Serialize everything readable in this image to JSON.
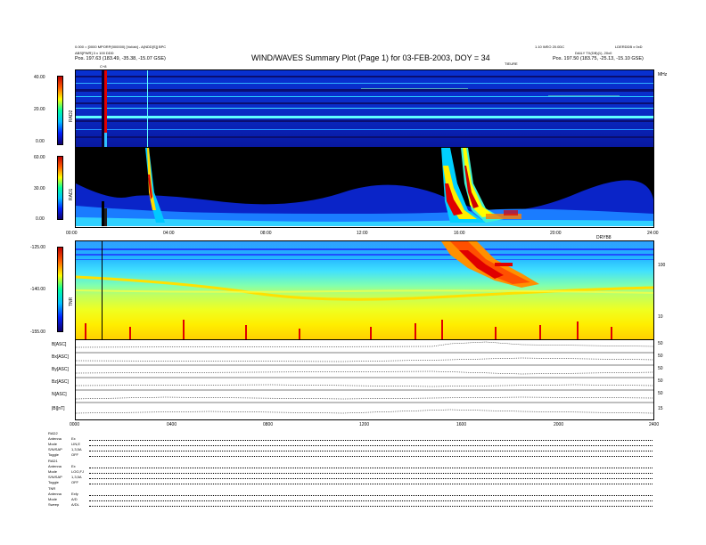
{
  "header": {
    "title": "WIND/WAVES Summary Plot (Page 1) for 03-FEB-2003, DOY = 34",
    "left_line1": "0.000 = [0000 MPORP(000000) [Vol/ab] - A(NDD[S]] BPC",
    "left_line2": "ABS[PWR] 3 x 100 DDD",
    "left_pos": "Pos.   197.63 (183.49, -35.38, -15.07 GSE)",
    "right_line1": "1.10 WEO 20.0DC",
    "right_line1b": "LDERDDB x 0xD",
    "right_line2": "DAILY TX(DB)(1), 20x0",
    "right_pos": "Pos.   197.50 (183.75, -25.13, -15.10 GSE)",
    "top_marker": "C+8",
    "top_mid_label": "TIEURE"
  },
  "chart_data": [
    {
      "type": "heatmap",
      "name": "RAD2",
      "ylabel": "RAD2",
      "colorbar_ticks": [
        "40.00",
        "20.00",
        "0.00"
      ],
      "right_label": "MHz",
      "right_tick": "13"
    },
    {
      "type": "heatmap",
      "name": "RAD1",
      "ylabel": "RAD1",
      "colorbar_ticks": [
        "60.00",
        "30.00",
        "0.00"
      ],
      "xticks": [
        "00:00",
        "04:00",
        "08:00",
        "12:00",
        "16:00",
        "20:00",
        "24:00"
      ],
      "x_units": "DRYB8"
    },
    {
      "type": "heatmap",
      "name": "TNR",
      "ylabel": "TNR",
      "colorbar_ticks": [
        "-125.00",
        "-140.00",
        "-155.00"
      ],
      "right_ticks": [
        "100",
        "10"
      ]
    },
    {
      "type": "line",
      "name": "MFI / SWE summary",
      "panels": [
        {
          "label": "B[ASC]",
          "right_ticks": [
            "50",
            "0"
          ]
        },
        {
          "label": "Bx[ASC]",
          "right_ticks": [
            "50",
            "0"
          ]
        },
        {
          "label": "By[ASC]",
          "right_ticks": [
            "50",
            "0"
          ]
        },
        {
          "label": "Bz[ASC]",
          "right_ticks": [
            "50",
            "0"
          ]
        },
        {
          "label": "N[ASC]",
          "right_ticks": [
            "50",
            "0"
          ]
        },
        {
          "label": "|B|[nT]",
          "right_ticks": [
            "15",
            "0"
          ]
        }
      ],
      "xticks": [
        "0000",
        "0400",
        "0800",
        "1200",
        "1600",
        "2000",
        "2400"
      ]
    }
  ],
  "footer": {
    "rad2_title": "RAD2",
    "rad2_rows": [
      {
        "k": "Antenna",
        "v": "Ex"
      },
      {
        "k": "Mode",
        "v": "LIN,E"
      },
      {
        "k": "S/N/SAP",
        "v": "1,3,5A"
      },
      {
        "k": "Toggle",
        "v": "OFF"
      }
    ],
    "rad1_title": "RAD1",
    "rad1_rows": [
      {
        "k": "Antenna",
        "v": "Ex"
      },
      {
        "k": "Mode",
        "v": "LOG,FJ"
      },
      {
        "k": "S/N/SAP",
        "v": "1,3,5A"
      },
      {
        "k": "Toggle",
        "v": "OFF"
      }
    ],
    "tnr_title": "TNR",
    "tnr_rows": [
      {
        "k": "Antenna",
        "v": "Exfy"
      },
      {
        "k": "Mode",
        "v": "A/D"
      },
      {
        "k": "Sweep",
        "v": "A/DL"
      }
    ]
  }
}
